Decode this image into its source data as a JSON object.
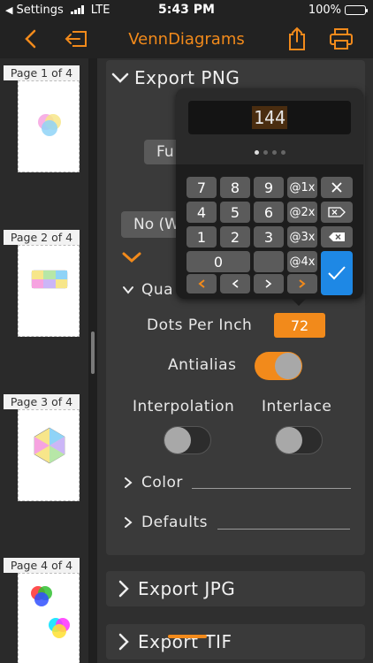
{
  "status_bar": {
    "carrier": "Settings",
    "network": "LTE",
    "time": "5:43 PM",
    "battery_percent": "100%",
    "battery_level": 1.0
  },
  "nav": {
    "title": "VennDiagrams"
  },
  "pages": [
    {
      "label": "Page 1 of 4"
    },
    {
      "label": "Page 2 of 4"
    },
    {
      "label": "Page 3 of 4"
    },
    {
      "label": "Page 4 of 4"
    }
  ],
  "export_png": {
    "title": "Export PNG",
    "size_button": "Fu",
    "transparency_button": "No (W",
    "quality_label": "Qua",
    "dpi_label": "Dots Per Inch",
    "dpi_value": "72",
    "antialias_label": "Antialias",
    "antialias_on": true,
    "interpolation_label": "Interpolation",
    "interpolation_on": false,
    "interlace_label": "Interlace",
    "interlace_on": false,
    "color_label": "Color",
    "defaults_label": "Defaults"
  },
  "export_jpg": {
    "title": "Export JPG"
  },
  "export_tif": {
    "title": "Export TIF"
  },
  "keypad": {
    "display_value": "144",
    "keys": {
      "k7": "7",
      "k8": "8",
      "k9": "9",
      "at1x": "@1x",
      "k4": "4",
      "k5": "5",
      "k6": "6",
      "at2x": "@2x",
      "k1": "1",
      "k2": "2",
      "k3": "3",
      "at3x": "@3x",
      "k0": "0",
      "at4x": "@4x"
    }
  },
  "colors": {
    "accent": "#f28a1b",
    "confirm": "#1e88e5"
  }
}
